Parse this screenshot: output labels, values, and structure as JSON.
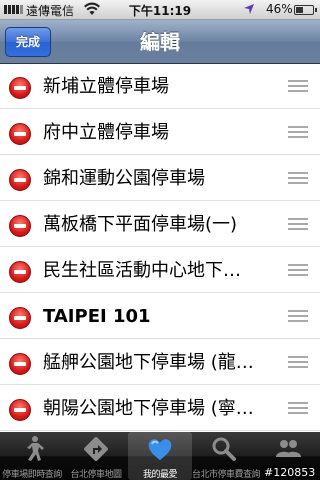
{
  "status_bar": {
    "carrier": "遠傳電信",
    "time": "下午11:19",
    "battery_percent": "46%",
    "battery_level": 0.46
  },
  "nav_bar": {
    "done_label": "完成",
    "title": "編輯"
  },
  "items": [
    {
      "label": "新埔立體停車場"
    },
    {
      "label": "府中立體停車場"
    },
    {
      "label": "錦和運動公園停車場"
    },
    {
      "label": "萬板橋下平面停車場(一)"
    },
    {
      "label": "民生社區活動中心地下…"
    },
    {
      "label": "TAIPEI 101"
    },
    {
      "label": "艋舺公園地下停車場 (龍…"
    },
    {
      "label": "朝陽公園地下停車場 (寧…"
    }
  ],
  "tab_bar": {
    "tabs": [
      {
        "label": "停車場即時查詢",
        "icon": "running-person-icon"
      },
      {
        "label": "台北停車地圖",
        "icon": "turn-sign-icon"
      },
      {
        "label": "我的最愛",
        "icon": "heart-icon",
        "active": true
      },
      {
        "label": "台北市停車費查詢",
        "icon": "magnifier-icon"
      },
      {
        "label": "",
        "icon": "people-icon"
      }
    ]
  },
  "overlay_id": "#120853",
  "colors": {
    "nav_bar": "#6d84a2",
    "done_button": "#2962d3",
    "delete_red": "#d71a1a",
    "heart_blue": "#3a8ee8"
  }
}
